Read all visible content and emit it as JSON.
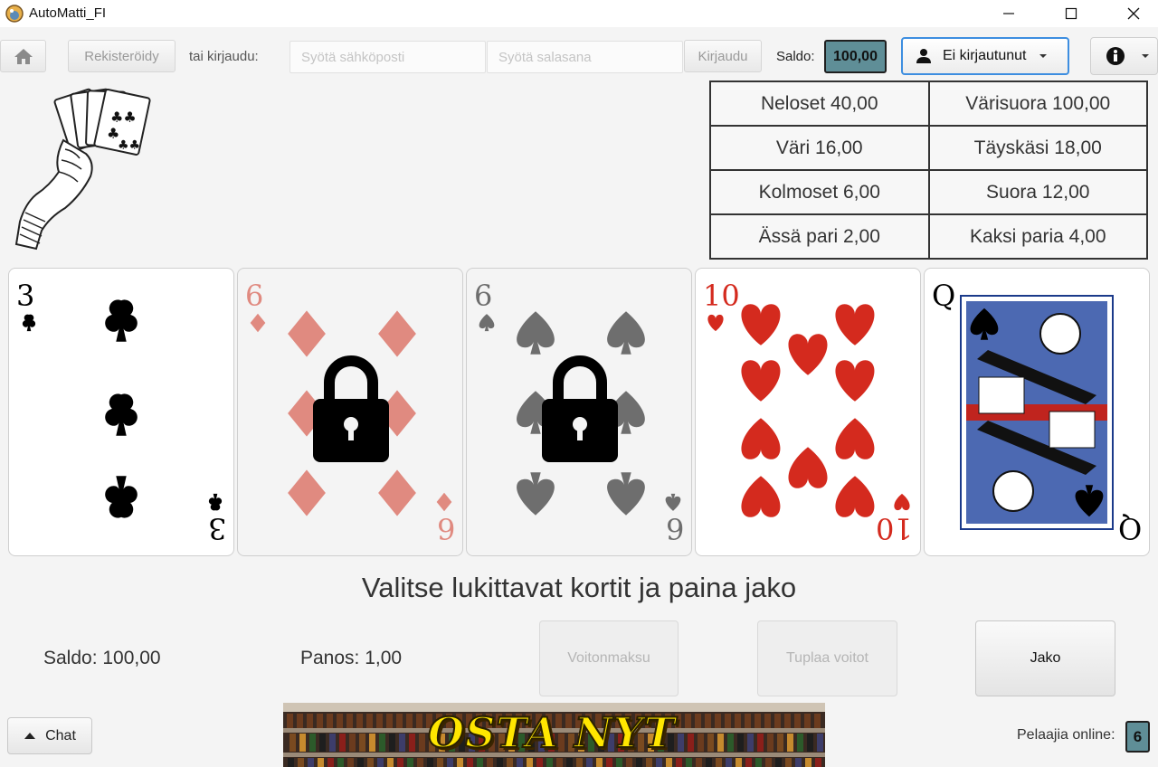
{
  "window": {
    "title": "AutoMatti_FI"
  },
  "toolbar": {
    "register_label": "Rekisteröidy",
    "or_login_label": "tai kirjaudu:",
    "email_placeholder": "Syötä sähköposti",
    "password_placeholder": "Syötä salasana",
    "login_label": "Kirjaudu",
    "saldo_label": "Saldo:",
    "saldo_value": "100,00",
    "user_label": "Ei kirjautunut"
  },
  "paytable": [
    {
      "left": "Neloset 40,00",
      "right": "Värisuora 100,00"
    },
    {
      "left": "Väri 16,00",
      "right": "Täyskäsi 18,00"
    },
    {
      "left": "Kolmoset 6,00",
      "right": "Suora 12,00"
    },
    {
      "left": "Ässä pari 2,00",
      "right": "Kaksi paria 4,00"
    }
  ],
  "cards": [
    {
      "rank": "3",
      "suit": "clubs",
      "locked": false
    },
    {
      "rank": "6",
      "suit": "diamonds",
      "locked": true
    },
    {
      "rank": "6",
      "suit": "spades",
      "locked": true
    },
    {
      "rank": "10",
      "suit": "hearts",
      "locked": false
    },
    {
      "rank": "Q",
      "suit": "spades",
      "locked": false
    }
  ],
  "game": {
    "message": "Valitse lukittavat kortit ja paina jako",
    "saldo_text": "Saldo: 100,00",
    "panos_text": "Panos: 1,00",
    "payout_label": "Voitonmaksu",
    "double_label": "Tuplaa voitot",
    "deal_label": "Jako"
  },
  "footer": {
    "chat_label": "Chat",
    "ad_text": "OSTA NYT",
    "online_label": "Pelaajia online:",
    "online_count": "6"
  },
  "colors": {
    "accent_teal": "#5f8e97",
    "focus_blue": "#3d8ee0",
    "red_suit": "#d42a1e",
    "locked_red": "#e08a80",
    "locked_black": "#6e6e6e"
  }
}
